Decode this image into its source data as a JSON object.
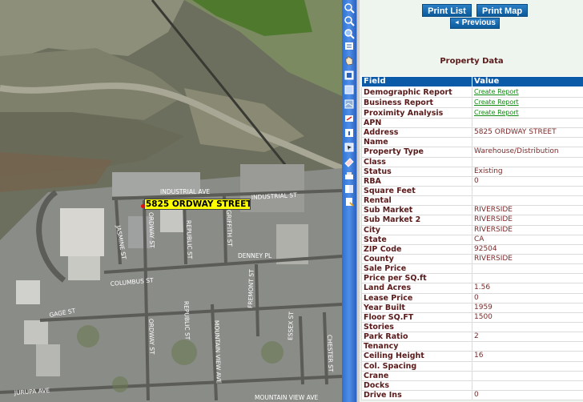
{
  "map": {
    "highlight_label": "5825 ORDWAY STREET",
    "streets": {
      "industrial_ave": "INDUSTRIAL AVE",
      "industrial_st": "INDUSTRIAL ST",
      "jasmine_st": "JASMINE ST",
      "ordway_st_1": "ORDWAY ST",
      "republic_st_1": "REPUBLIC ST",
      "griffith_st": "GRIFFITH ST",
      "denney_pl": "DENNEY PL",
      "columbus_st": "COLUMBUS ST",
      "fremont_st": "FREMONT ST",
      "gage_st": "GAGE ST",
      "ordway_st_2": "ORDWAY ST",
      "republic_st_2": "REPUBLIC ST",
      "mountain_view_ave_1": "MOUNTAIN VIEW AVE",
      "essex_st": "ESSEX ST",
      "chester_st": "CHESTER ST",
      "jurupa_ave": "JURUPA AVE",
      "mountain_view_ave_2": "MOUNTAIN VIEW AVE"
    }
  },
  "toolbar": {
    "icons": [
      "zoom-in-icon",
      "zoom-out-icon",
      "zoom-in-icon",
      "layers-icon",
      "pan-hand-icon",
      "map-icon",
      "map-icon",
      "aerial-icon",
      "measure-icon",
      "info-icon",
      "select-icon",
      "eraser-icon",
      "print-icon",
      "book-icon",
      "report-icon"
    ]
  },
  "panel": {
    "print_list": "Print List",
    "print_map": "Print Map",
    "previous": "Previous",
    "previous_arrow": "◄",
    "title": "Property Data",
    "col_field": "Field",
    "col_value": "Value",
    "rows": [
      {
        "field": "Demographic Report",
        "value": "Create Report",
        "link": true
      },
      {
        "field": "Business Report",
        "value": "Create Report",
        "link": true
      },
      {
        "field": "Proximity Analysis",
        "value": "Create Report",
        "link": true
      },
      {
        "field": "APN",
        "value": ""
      },
      {
        "field": "Address",
        "value": "5825 ORDWAY STREET"
      },
      {
        "field": "Name",
        "value": ""
      },
      {
        "field": "Property Type",
        "value": "Warehouse/Distribution"
      },
      {
        "field": "Class",
        "value": ""
      },
      {
        "field": "Status",
        "value": "Existing"
      },
      {
        "field": "RBA",
        "value": "0"
      },
      {
        "field": "Square Feet",
        "value": ""
      },
      {
        "field": "Rental",
        "value": ""
      },
      {
        "field": "Sub Market",
        "value": "RIVERSIDE"
      },
      {
        "field": "Sub Market 2",
        "value": "RIVERSIDE"
      },
      {
        "field": "City",
        "value": "RIVERSIDE"
      },
      {
        "field": "State",
        "value": "CA"
      },
      {
        "field": "ZIP Code",
        "value": "92504"
      },
      {
        "field": "County",
        "value": "RIVERSIDE"
      },
      {
        "field": "Sale Price",
        "value": ""
      },
      {
        "field": "Price per SQ.ft",
        "value": ""
      },
      {
        "field": "Land Acres",
        "value": "1.56"
      },
      {
        "field": "Lease Price",
        "value": "0"
      },
      {
        "field": "Year Built",
        "value": "1959"
      },
      {
        "field": "Floor SQ.FT",
        "value": "1500"
      },
      {
        "field": "Stories",
        "value": ""
      },
      {
        "field": "Park Ratio",
        "value": "2"
      },
      {
        "field": "Tenancy",
        "value": ""
      },
      {
        "field": "Ceiling Height",
        "value": "16"
      },
      {
        "field": "Col. Spacing",
        "value": ""
      },
      {
        "field": "Crane",
        "value": ""
      },
      {
        "field": "Docks",
        "value": ""
      },
      {
        "field": "Drive Ins",
        "value": "0"
      }
    ]
  },
  "colors": {
    "table_header": "#0b5aa8",
    "field_text": "#5a1a1a",
    "link": "#108a10",
    "toolbar": "#2e6fd0",
    "highlight": "#ffff00"
  }
}
